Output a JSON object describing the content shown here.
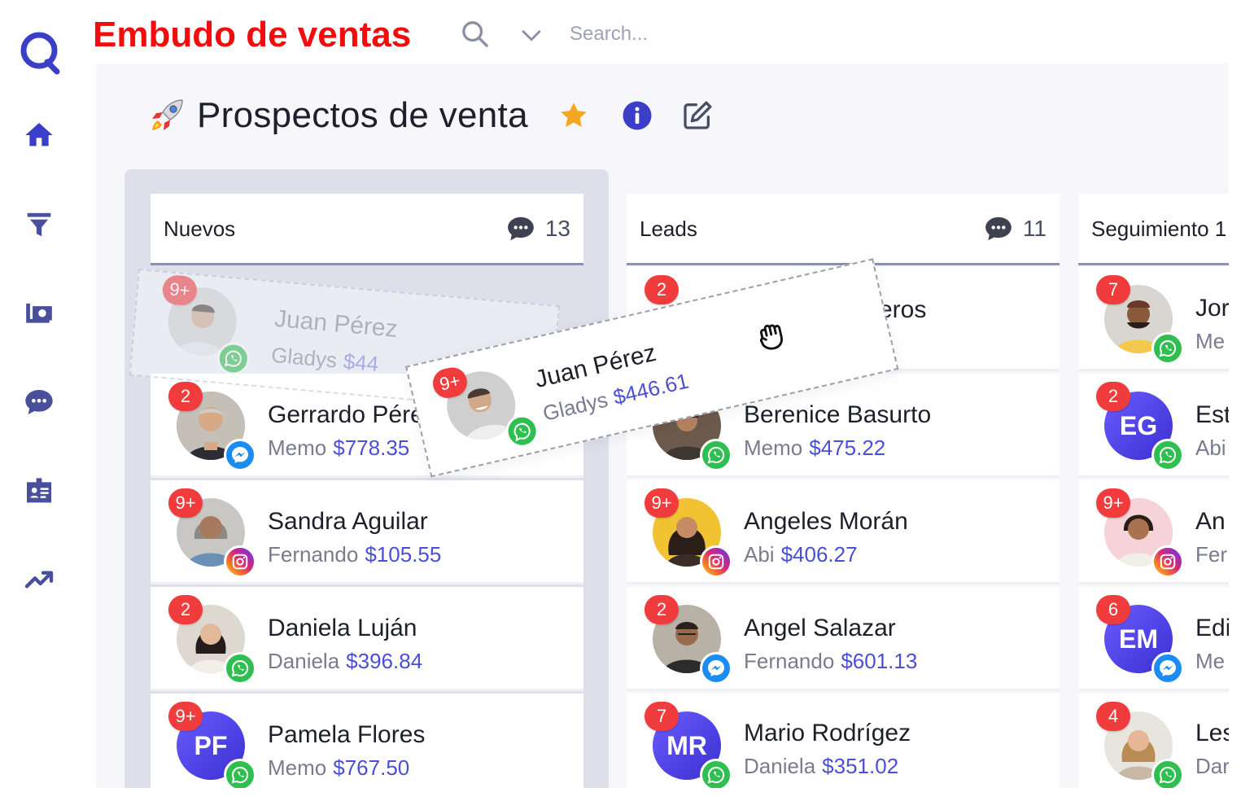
{
  "brand": {
    "title": "Embudo de ventas"
  },
  "topbar": {
    "search_placeholder": "Search..."
  },
  "page": {
    "title": "Prospectos de venta"
  },
  "colors": {
    "primary": "#3b3fc7",
    "amount": "#4b4fd6",
    "badge": "#f03c3c",
    "whatsapp": "#2fbf51",
    "messenger": "#1b8cf2",
    "brand_title": "#f30c0c",
    "star": "#f5a623"
  },
  "sidebar": {
    "items": [
      {
        "icon": "home-icon"
      },
      {
        "icon": "funnel-icon"
      },
      {
        "icon": "camera-folder-icon"
      },
      {
        "icon": "chat-icon"
      },
      {
        "icon": "contact-card-icon"
      },
      {
        "icon": "trending-up-icon"
      }
    ]
  },
  "columns": [
    {
      "title": "Nuevos",
      "count": "13",
      "cards": [
        {
          "name": "Gerrardo Pérez",
          "owner": "Memo",
          "amount": "$778.35",
          "badge": "2",
          "channel": "messenger"
        },
        {
          "name": "Sandra Aguilar",
          "owner": "Fernando",
          "amount": "$105.55",
          "badge": "9+",
          "channel": "instagram"
        },
        {
          "name": "Daniela Luján",
          "owner": "Daniela",
          "amount": "$396.84",
          "badge": "2",
          "channel": "whatsapp"
        },
        {
          "name": "Pamela Flores",
          "owner": "Memo",
          "amount": "$767.50",
          "badge": "9+",
          "channel": "whatsapp",
          "initials": "PF"
        }
      ]
    },
    {
      "title": "Leads",
      "count": "11",
      "cards": [
        {
          "name": "Berenice Basurto",
          "owner": "Memo",
          "amount": "$475.22",
          "badge": "",
          "channel": "whatsapp"
        },
        {
          "name": "Angeles Morán",
          "owner": "Abi",
          "amount": "$406.27",
          "badge": "9+",
          "channel": "instagram"
        },
        {
          "name": "Angel Salazar",
          "owner": "Fernando",
          "amount": "$601.13",
          "badge": "2",
          "channel": "messenger"
        },
        {
          "name": "Mario Rodrígez",
          "owner": "Daniela",
          "amount": "$351.02",
          "badge": "7",
          "channel": "whatsapp",
          "initials": "MR"
        }
      ],
      "partial_top_card": {
        "name_fragment": "eros",
        "badge": "2"
      }
    },
    {
      "title": "Seguimiento 1",
      "cards": [
        {
          "name": "Jor",
          "owner": "Me",
          "badge": "7",
          "channel": "whatsapp"
        },
        {
          "name": "Est",
          "owner": "Abi",
          "badge": "2",
          "channel": "whatsapp",
          "initials": "EG"
        },
        {
          "name": "An",
          "owner": "Fer",
          "badge": "9+",
          "channel": "instagram"
        },
        {
          "name": "Edi",
          "owner": "Me",
          "badge": "6",
          "channel": "messenger",
          "initials": "EM"
        },
        {
          "name": "Les",
          "owner": "Dar",
          "badge": "4",
          "channel": "whatsapp"
        }
      ]
    }
  ],
  "dragged_card": {
    "name": "Juan Pérez",
    "owner": "Gladys",
    "amount": "$446.61",
    "badge": "9+",
    "channel": "whatsapp"
  },
  "ghost_card": {
    "name": "Juan Pérez",
    "owner": "Gladys",
    "amount": "$44",
    "badge": "9+",
    "channel": "whatsapp"
  }
}
